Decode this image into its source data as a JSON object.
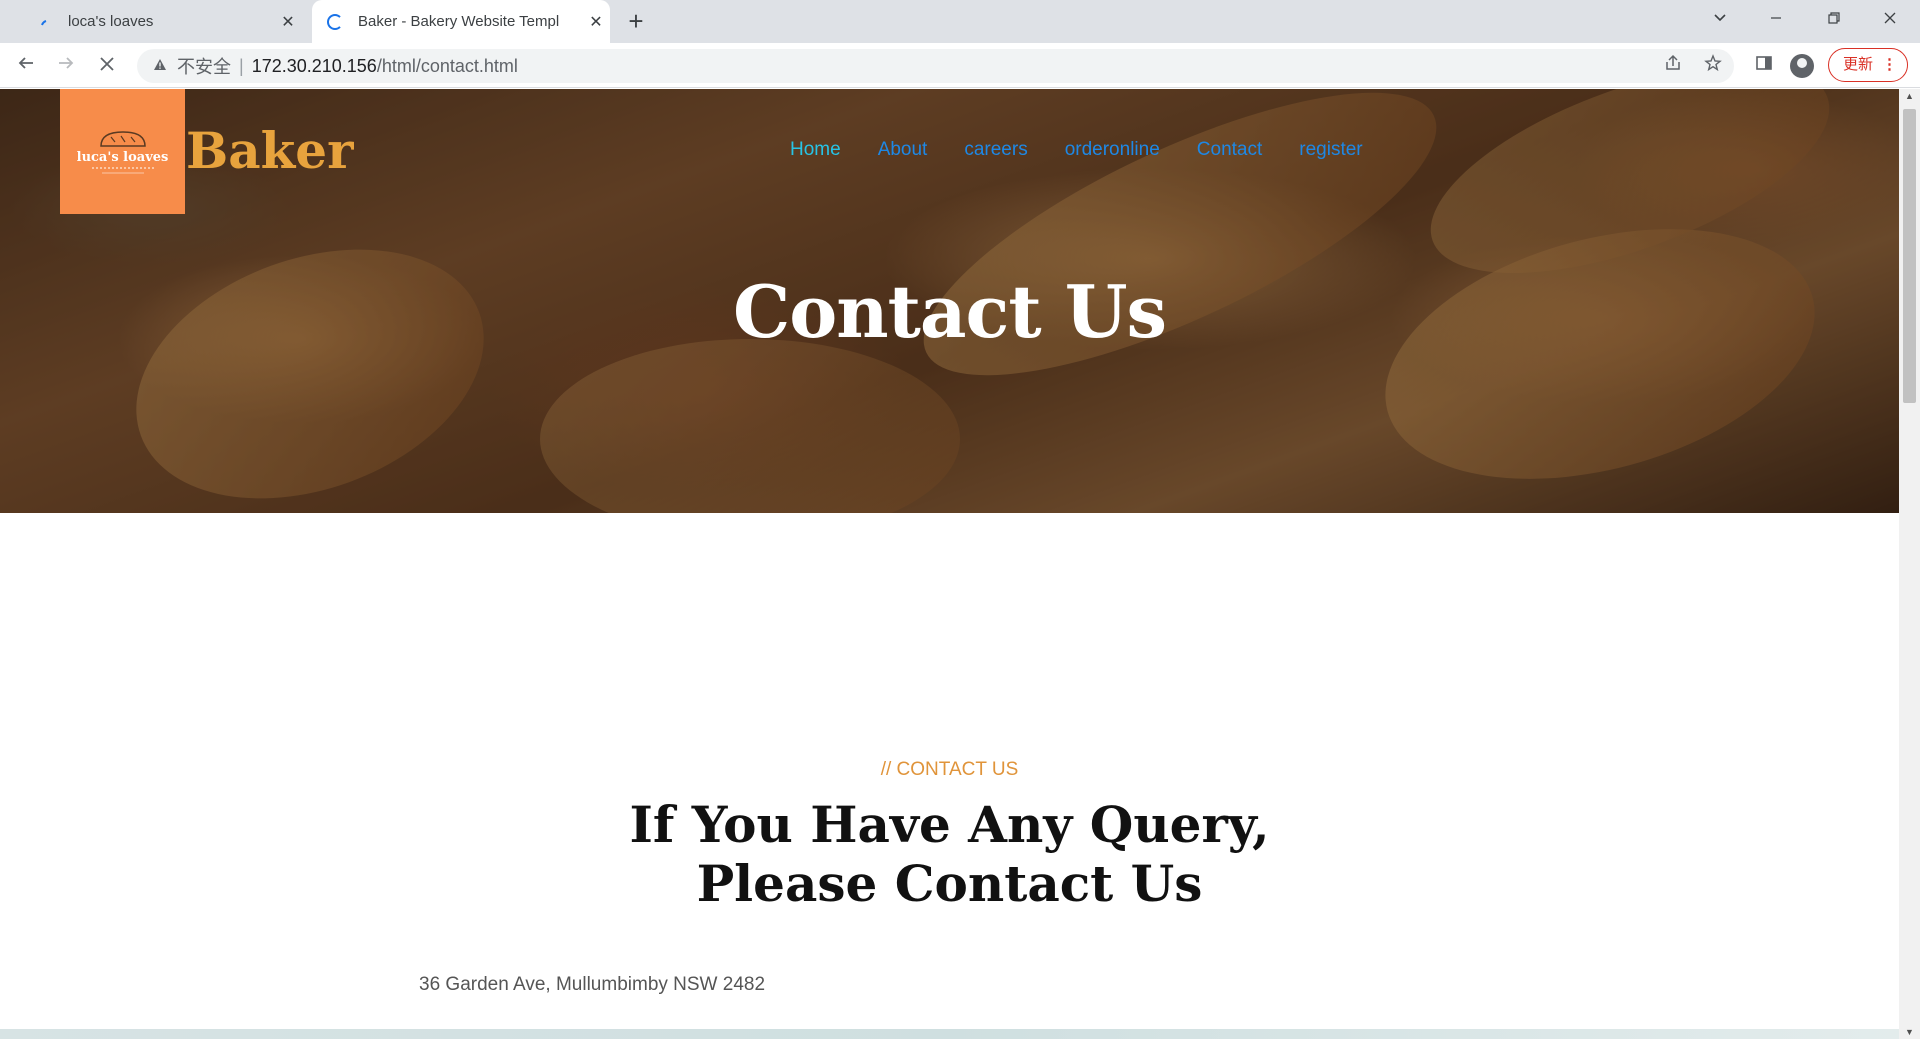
{
  "browser": {
    "tabs": [
      {
        "title": "loca's loaves",
        "active": false
      },
      {
        "title": "Baker - Bakery Website Templ",
        "active": true
      }
    ],
    "new_tab_symbol": "+",
    "close_symbol": "✕",
    "omnibox": {
      "security_label": "不安全",
      "separator": "|",
      "host": "172.30.210.156",
      "path": "/html/contact.html"
    },
    "update_label": "更新",
    "update_menu_symbol": "⋮"
  },
  "site": {
    "logo_text": "luca's loaves",
    "brand": "Baker",
    "nav": [
      {
        "label": "Home",
        "current": true
      },
      {
        "label": "About"
      },
      {
        "label": "careers"
      },
      {
        "label": "orderonline"
      },
      {
        "label": "Contact"
      },
      {
        "label": "register"
      }
    ],
    "hero_title": "Contact Us",
    "kicker": "// CONTACT US",
    "heading_line1": "If You Have Any Query,",
    "heading_line2": "Please Contact Us",
    "address": "36 Garden Ave, Mullumbimby NSW 2482"
  },
  "colors": {
    "brand": "#e8a33d",
    "logo_bg": "#f78c4a",
    "nav_link": "#1e88e5",
    "nav_current": "#27c4e6",
    "kicker": "#e0943a"
  },
  "icons": [
    "back-icon",
    "forward-icon",
    "stop-icon",
    "warning-icon",
    "share-icon",
    "star-icon",
    "sidepanel-icon",
    "profile-icon",
    "chevron-down-icon",
    "minimize-icon",
    "restore-icon",
    "close-icon"
  ]
}
